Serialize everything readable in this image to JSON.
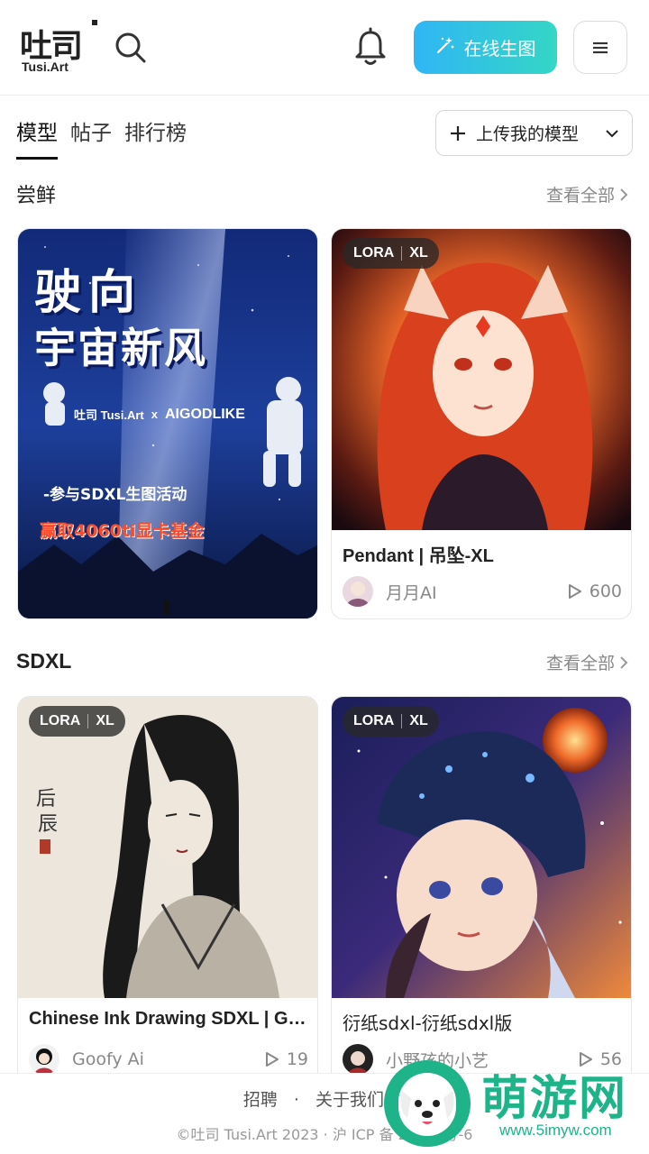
{
  "header": {
    "logo_zh": "吐司",
    "logo_en": "Tusi.Art",
    "generate_label": "在线生图"
  },
  "tabs": [
    {
      "label": "模型",
      "active": true
    },
    {
      "label": "帖子",
      "active": false
    },
    {
      "label": "排行榜",
      "active": false
    }
  ],
  "upload_label": "上传我的模型",
  "sections": [
    {
      "title": "尝鲜",
      "view_all": "查看全部",
      "cards": [
        {
          "banner": {
            "line1": "驶向",
            "line2": "宇宙新风",
            "brand_left": "吐司 Tusi.Art",
            "cross": "x",
            "brand_right": "AIGODLIKE",
            "promo1": "-参与SDXL生图活动",
            "promo2": "赢取4060ti显卡基金"
          }
        },
        {
          "badge": [
            "LORA",
            "XL"
          ],
          "title": "Pendant | 吊坠-XL",
          "author": "月月AI",
          "plays": "600"
        }
      ]
    },
    {
      "title": "SDXL",
      "view_all": "查看全部",
      "cards": [
        {
          "badge": [
            "LORA",
            "XL"
          ],
          "title": "Chinese Ink Drawing SDXL | Go...",
          "author": "Goofy Ai",
          "plays": "19"
        },
        {
          "badge": [
            "LORA",
            "XL"
          ],
          "title": "衍纸sdxl-衍纸sdxl版",
          "author": "小野孩的小艺",
          "plays": "56"
        }
      ]
    }
  ],
  "footer": {
    "links": [
      "招聘",
      "关于我们"
    ],
    "separator": "·",
    "copyright": "©吐司 Tusi.Art 2023 · 沪 ICP 备 20...9 号-6"
  },
  "watermark": {
    "text": "萌游网",
    "url": "www.5imyw.com"
  },
  "colors": {
    "gen_gradient_start": "#2fb6f5",
    "gen_gradient_end": "#35d6c6",
    "watermark": "#1fb38a"
  }
}
